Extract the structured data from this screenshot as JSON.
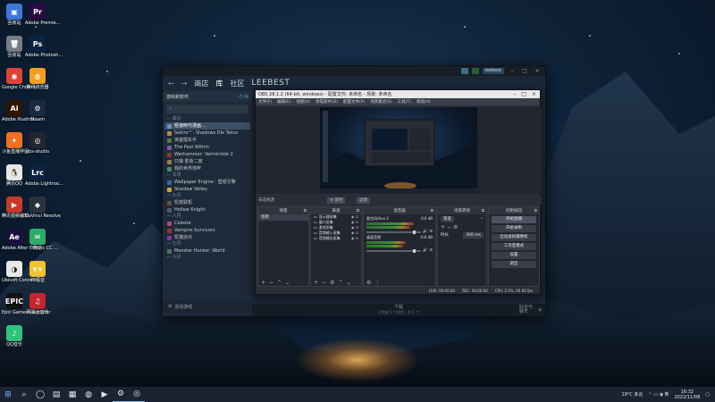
{
  "desktop": {
    "icons": [
      {
        "label": "回收站",
        "color": "#3c78d8",
        "glyph": "▣"
      },
      {
        "label": "Adobe Premie...",
        "color": "#2a0a45",
        "glyph": "Pr"
      },
      {
        "label": "回收站",
        "color": "#777c85",
        "glyph": "🗑"
      },
      {
        "label": "Adobe Photosh...",
        "color": "#0b2340",
        "glyph": "Ps"
      },
      {
        "label": "Google Chrome",
        "color": "#db4437",
        "glyph": "◉"
      },
      {
        "label": "腾讯浏览器",
        "color": "#f0a020",
        "glyph": "◍"
      },
      {
        "label": "Adobe Illustrat...",
        "color": "#2f1400",
        "glyph": "Ai"
      },
      {
        "label": "Steam",
        "color": "#1a2a3f",
        "glyph": "⚙"
      },
      {
        "label": "斗鱼直播伴侣",
        "color": "#f07020",
        "glyph": "✦"
      },
      {
        "label": "obs-studio",
        "color": "#222530",
        "glyph": "◎"
      },
      {
        "label": "腾讯QQ",
        "color": "#e8e8e8",
        "glyph": "🐧"
      },
      {
        "label": "Adobe Lightroo...",
        "color": "#0b2340",
        "glyph": "Lrc"
      },
      {
        "label": "腾讯视频编辑",
        "color": "#c73a2a",
        "glyph": "▶"
      },
      {
        "label": "DaVinci Resolve",
        "color": "#2a3240",
        "glyph": "◆"
      },
      {
        "label": "Adobe After Effects CC ...",
        "color": "#1a0f3c",
        "glyph": "Ae"
      },
      {
        "label": "微信",
        "color": "#2aae67",
        "glyph": "✉"
      },
      {
        "label": "Ubisoft Connect",
        "color": "#e8e8e8",
        "glyph": "◑"
      },
      {
        "label": "YY语音",
        "color": "#f1c232",
        "glyph": "ʏʏ"
      },
      {
        "label": "Epic Games Launcher",
        "color": "#111",
        "glyph": "EPIC"
      },
      {
        "label": "网易云音乐",
        "color": "#c0262c",
        "glyph": "♫"
      },
      {
        "label": "QQ音乐",
        "color": "#31c27c",
        "glyph": "♪"
      }
    ]
  },
  "steam": {
    "nav_back": "←",
    "nav_forward": "→",
    "nav_store": "商店",
    "nav_library": "库",
    "nav_community": "社区",
    "user": "LEEBEST",
    "account": "leebest",
    "minimize": "–",
    "maximize": "□",
    "close": "×",
    "sidebar_title": "游戏和软件",
    "search_icon": "⌕",
    "sections": [
      {
        "title": "最近",
        "items": [
          {
            "name": "極速時代漫画...",
            "color": "#6a8fb5",
            "selected": true
          },
          {
            "name": "Sekiro™: Shadows Die Twice",
            "color": "#b5894a",
            "selected": false
          },
          {
            "name": "侠盗猎车手",
            "color": "#5a7a3a",
            "selected": false
          },
          {
            "name": "The Past Within",
            "color": "#7a5a9a",
            "selected": false
          },
          {
            "name": "Warhammer: Vermintide 2",
            "color": "#8a3a2a",
            "selected": false
          },
          {
            "name": "只狼 影逝二度",
            "color": "#9a7a4a",
            "selected": false
          },
          {
            "name": "我的世界地牢",
            "color": "#4a8a6a",
            "selected": false
          }
        ]
      },
      {
        "title": "本周",
        "items": [
          {
            "name": "Wallpaper Engine：壁纸引擎",
            "color": "#3a6aa0",
            "selected": false
          },
          {
            "name": "Stardew Valley",
            "color": "#d0a040",
            "selected": false
          }
        ]
      },
      {
        "title": "九月",
        "items": [
          {
            "name": "饥荒联机",
            "color": "#6a4a3a",
            "selected": false
          },
          {
            "name": "Hollow Knight",
            "color": "#4a5a7a",
            "selected": false
          }
        ]
      },
      {
        "title": "八月",
        "items": [
          {
            "name": "Celeste",
            "color": "#b04a7a",
            "selected": false
          },
          {
            "name": "Vampire Survivors",
            "color": "#a03030",
            "selected": false
          },
          {
            "name": "饥饿派对",
            "color": "#7a3aa0",
            "selected": false
          }
        ]
      },
      {
        "title": "七月",
        "items": [
          {
            "name": "Monster Hunter: World",
            "color": "#4a7a5a",
            "selected": false
          }
        ]
      },
      {
        "title": "六月",
        "items": []
      }
    ],
    "add_game": "添加游戏",
    "footer_center": "下载",
    "footer_sub": "已完成 1 个项目，共 1 个",
    "friends": "好友与\n聊天",
    "footer_plus": "+"
  },
  "obs": {
    "title": "OBS 28.1.2 (64-bit, windows) - 配置文件: 未命名 - 场景: 未命名",
    "minimize": "–",
    "maximize": "□",
    "close": "×",
    "menus": [
      "文件(F)",
      "编辑(E)",
      "视图(V)",
      "停靠部件(D)",
      "配置文件(P)",
      "场景集合(S)",
      "工具(T)",
      "帮助(H)"
    ],
    "no_source": "未选择源",
    "props_btn": "⚙ 属性",
    "filters_btn": "滤镜",
    "docks": {
      "scenes": "场景",
      "sources": "来源",
      "mixer": "混音器",
      "transitions": "场景转场",
      "controls": "控制按钮"
    },
    "scene_items": [
      "场景"
    ],
    "sources": [
      "显示器采集",
      "窗口采集",
      "游戏采集",
      "音频输入采集",
      "音频输出采集"
    ],
    "mixer_channels": [
      {
        "name": "麦克风/Aux 2",
        "db": "0.0 dB",
        "level": 0.72
      },
      {
        "name": "桌面音频",
        "db": "-0.6 dB",
        "level": 0.6
      }
    ],
    "transition_type": "渐变",
    "duration_label": "时长",
    "duration_value": "300 ms",
    "controls": [
      "开始直播",
      "开始录制",
      "启动虚拟摄像机",
      "工作室模式",
      "设置",
      "退出"
    ],
    "status": {
      "live": "LIVE: 00:00:00",
      "rec": "REC: 00:00:00",
      "cpu": "CPU: 2.5%, 60.00 fps"
    }
  },
  "taskbar": {
    "start": "⊞",
    "search": "⌕",
    "icons": [
      "◯",
      "▤",
      "▦",
      "◍",
      "▶",
      "⚙",
      "◎"
    ],
    "weather": "19°C 多云",
    "time": "16:32",
    "date": "2022/11/08"
  }
}
